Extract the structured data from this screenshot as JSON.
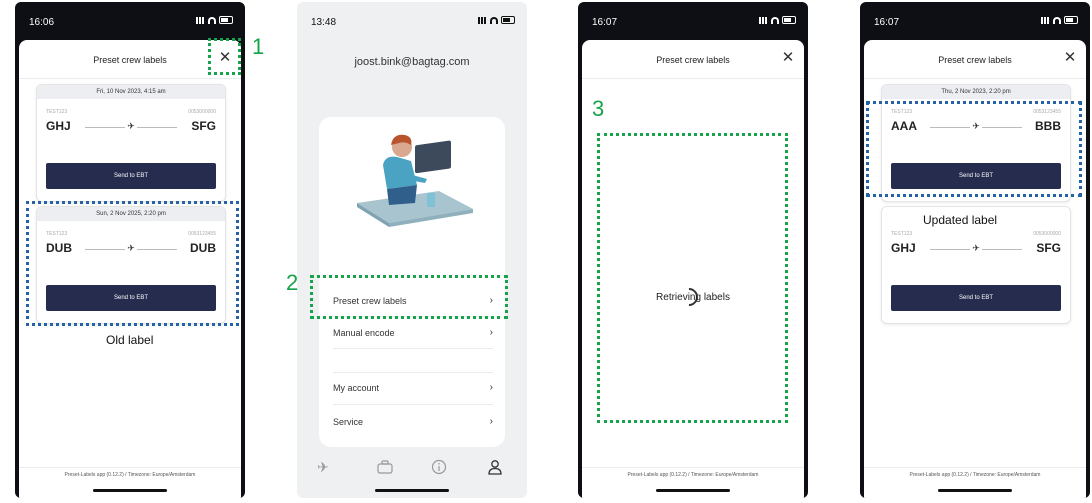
{
  "colors": {
    "green_annotation": "#16a34a",
    "blue_annotation": "#2663a5",
    "button_navy": "#252c4e"
  },
  "phones": [
    {
      "status_time": "16:06",
      "sheet_title": "Preset crew labels",
      "close_icon": "close-icon",
      "cards": [
        {
          "date": "Fri, 10 Nov 2023, 4:15 am",
          "code_left": "TEST123",
          "code_right": "0053000000",
          "from": "GHJ",
          "to": "SFG",
          "button": "Send to EBT"
        },
        {
          "date": "Sun, 2 Nov 2025, 2:20 pm",
          "code_left": "TEST123",
          "code_right": "0053123455",
          "from": "DUB",
          "to": "DUB",
          "button": "Send to EBT"
        }
      ],
      "footer": "Preset-Labels app (0.12.2) / Timezone: Europe/Amsterdam"
    },
    {
      "status_time": "13:48",
      "email": "joost.bink@bagtag.com",
      "menu": [
        "Preset crew labels",
        "Manual encode",
        "My account",
        "Service"
      ],
      "tabs": [
        "plane-icon",
        "briefcase-icon",
        "info-icon",
        "user-icon"
      ]
    },
    {
      "status_time": "16:07",
      "sheet_title": "Preset crew labels",
      "loading": "Retrieving labels",
      "footer": "Preset-Labels app (0.12.2) / Timezone: Europe/Amsterdam"
    },
    {
      "status_time": "16:07",
      "sheet_title": "Preset crew labels",
      "cards": [
        {
          "date": "Thu, 2 Nov 2023, 2:20 pm",
          "code_left": "TEST123",
          "code_right": "0053123455",
          "from": "AAA",
          "to": "BBB",
          "button": "Send to EBT"
        },
        {
          "date": "",
          "code_left": "TEST123",
          "code_right": "0053000000",
          "from": "GHJ",
          "to": "SFG",
          "button": "Send to EBT"
        }
      ],
      "footer": "Preset-Labels app (0.12.2) / Timezone: Europe/Amsterdam"
    }
  ],
  "annotations": {
    "step1": "1",
    "step2": "2",
    "step3": "3",
    "old_label": "Old label",
    "updated_label": "Updated label"
  }
}
